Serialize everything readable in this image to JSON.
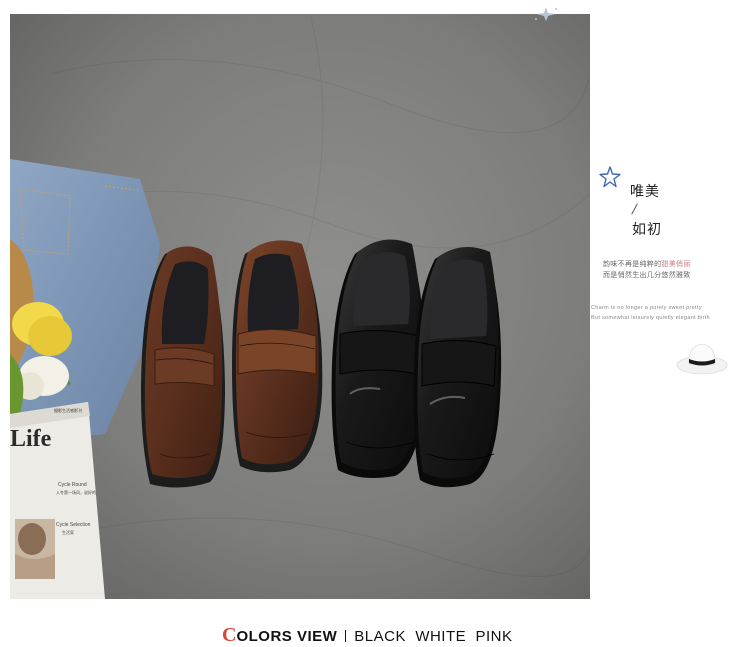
{
  "side_panel": {
    "heading_line1": "唯美",
    "heading_line2": "如初",
    "cn_line1_pre": "韵味不再是纯粹的",
    "cn_line1_highlight": "甜美俏丽",
    "cn_line2": "而是悄然生出几分悠然雅致",
    "en_line1": "Charm is no longer a purely sweet pretty",
    "en_line2": "But somewhat leisurely quietly elegant birth"
  },
  "magazine": {
    "small_header": "摄影生活感影刊",
    "title": "Life",
    "item1": "Cycle Round",
    "item1_sub": "入冬第一场风，说好的",
    "item2": "Cycle Selection",
    "item2_sub": "生活家"
  },
  "footer": {
    "accent_letter": "C",
    "label": "OLORS VIEW",
    "colors": "BLACK  WHITE  PINK"
  },
  "colors": {
    "accent_red": "#d8473b",
    "highlight_pink": "#c97b82",
    "star_blue": "#3e66b3"
  },
  "icons": [
    "sparkle-star-icon",
    "blue-star-icon",
    "hat-icon"
  ]
}
